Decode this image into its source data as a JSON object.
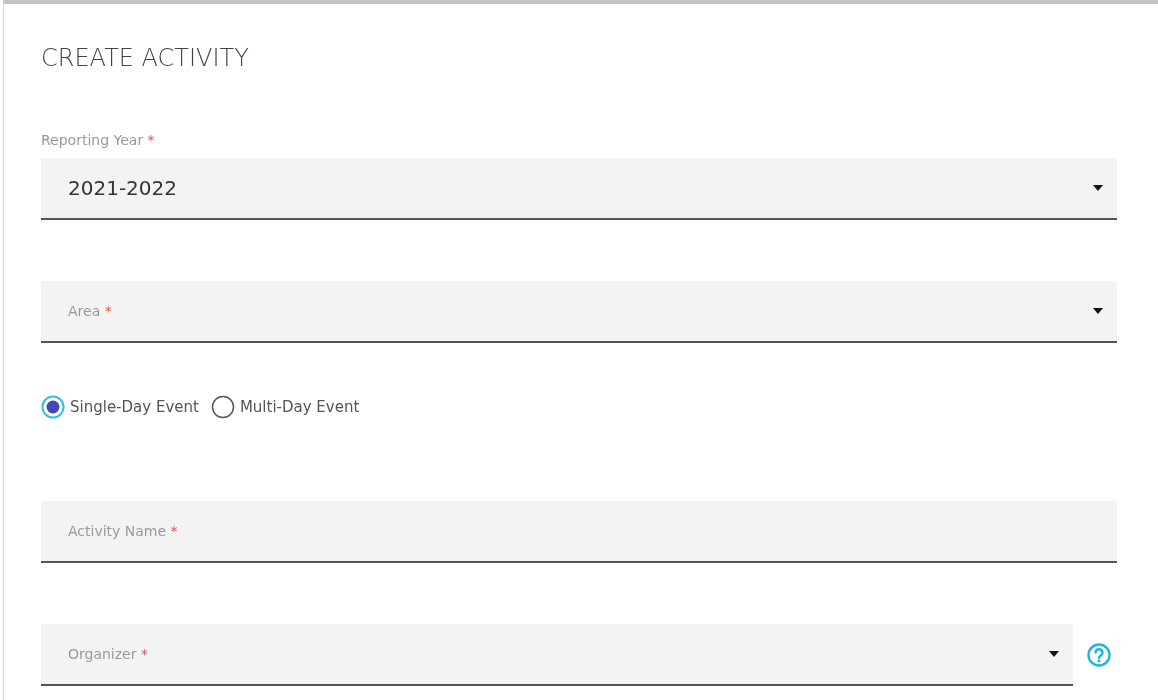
{
  "title": "CREATE ACTIVITY",
  "sections": [
    {
      "kind": "select",
      "label": "Reporting Year",
      "required_mark": "*",
      "value": "2021-2022",
      "help": false
    },
    {
      "kind": "select",
      "label": "Area",
      "required_mark": "*",
      "help": false
    },
    {
      "kind": "radios",
      "options": [
        {
          "label": "Single-Day Event",
          "selected": true
        },
        {
          "label": "Multi-Day Event",
          "selected": false
        }
      ]
    },
    {
      "kind": "text",
      "label": "Activity Name",
      "required_mark": "*",
      "help": false
    },
    {
      "kind": "select",
      "label": "Organizer",
      "required_mark": "*",
      "help": true
    }
  ]
}
